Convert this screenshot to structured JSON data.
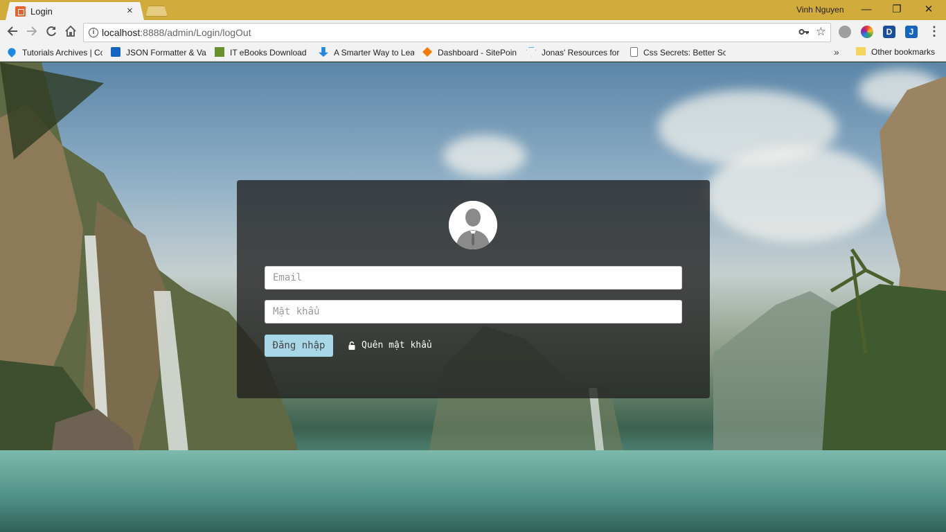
{
  "browser": {
    "tab_title": "Login",
    "user_name": "Vinh Nguyen",
    "url_host": "localhost",
    "url_path": ":8888/admin/Login/logOut",
    "close_glyph": "×",
    "minimize_glyph": "—",
    "restore_glyph": "❐",
    "window_close_glyph": "✕",
    "overflow_glyph": "»"
  },
  "bookmarks": [
    {
      "label": "Tutorials Archives | Co",
      "icon": "drop-icon",
      "color": "#1e88e5"
    },
    {
      "label": "JSON Formatter & Va",
      "icon": "check-icon",
      "color": "#1565c0"
    },
    {
      "label": "IT eBooks Download",
      "icon": "tree-icon",
      "color": "#6a8f2f"
    },
    {
      "label": "A Smarter Way to Lea",
      "icon": "arrow-down-icon",
      "color": "#1e88e5"
    },
    {
      "label": "Dashboard - SitePoin",
      "icon": "sitepoint-icon",
      "color": "#f57c00"
    },
    {
      "label": "Jonas' Resources for S",
      "icon": "diamond-icon",
      "color": "#4fc3f7"
    },
    {
      "label": "Css Secrets: Better So",
      "icon": "page-icon",
      "color": "#777777"
    }
  ],
  "other_bookmarks": "Other bookmarks",
  "login": {
    "email_placeholder": "Email",
    "password_placeholder": "Mật khẩu",
    "submit_label": "Đăng nhập",
    "forgot_label": "Quên mật khẩu"
  },
  "colors": {
    "titlebar": "#d1ab3c",
    "card_bg": "rgba(32,32,32,0.78)",
    "login_button": "#a8d8e8"
  }
}
